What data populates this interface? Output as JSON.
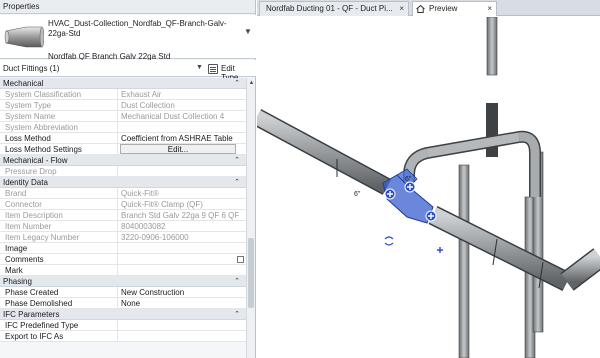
{
  "palette": {
    "title": "Properties",
    "type_name_line1": "HVAC_Dust-Collection_Nordfab_QF-Branch-Galv-22ga-Std",
    "type_name_line2": "Nordfab QF Branch Galv 22ga Std",
    "filter_label": "Duct Fittings (1)",
    "edit_type_label": "Edit Type"
  },
  "groups": [
    {
      "title": "Mechanical",
      "rows": [
        {
          "k": "System Classification",
          "v": "Exhaust Air",
          "ro": true
        },
        {
          "k": "System Type",
          "v": "Dust Collection",
          "ro": true
        },
        {
          "k": "System Name",
          "v": "Mechanical Dust Collection 4",
          "ro": true
        },
        {
          "k": "System Abbreviation",
          "v": "",
          "ro": true
        },
        {
          "k": "Loss Method",
          "v": "Coefficient from ASHRAE Table",
          "ro": false
        },
        {
          "k": "Loss Method Settings",
          "btn": "Edit...",
          "ro": false
        }
      ]
    },
    {
      "title": "Mechanical - Flow",
      "rows": [
        {
          "k": "Pressure Drop",
          "v": "",
          "ro": true
        }
      ]
    },
    {
      "title": "Identity Data",
      "rows": [
        {
          "k": "Brand",
          "v": "Quick-Fit®",
          "ro": true
        },
        {
          "k": "Connector",
          "v": "Quick-Fit® Clamp (QF)",
          "ro": true
        },
        {
          "k": "Item Description",
          "v": "Branch Std Galv 22ga 9 QF 6 QF",
          "ro": true
        },
        {
          "k": "Item Number",
          "v": "8040003082",
          "ro": true
        },
        {
          "k": "Item Legacy Number",
          "v": "3220-0906-106000",
          "ro": true
        },
        {
          "k": "Image",
          "v": "",
          "ro": false
        },
        {
          "k": "Comments",
          "v": "",
          "ro": false
        },
        {
          "k": "Mark",
          "v": "",
          "ro": false
        }
      ]
    },
    {
      "title": "Phasing",
      "rows": [
        {
          "k": "Phase Created",
          "v": "New Construction",
          "ro": false
        },
        {
          "k": "Phase Demolished",
          "v": "None",
          "ro": false
        }
      ]
    },
    {
      "title": "IFC Parameters",
      "rows": [
        {
          "k": "IFC Predefined Type",
          "v": "",
          "ro": false
        },
        {
          "k": "Export to IFC As",
          "v": "",
          "ro": false
        }
      ]
    }
  ],
  "tabs": {
    "ducting": "Nordfab Ducting 01 - QF - Duct Pi...",
    "preview": "Preview",
    "close_glyph": "×"
  },
  "view": {
    "dim_label_6": "6\"",
    "dim_label_6b": "6\""
  },
  "colors": {
    "selection": "#3a5fcf",
    "pipe": "#8f9396"
  }
}
